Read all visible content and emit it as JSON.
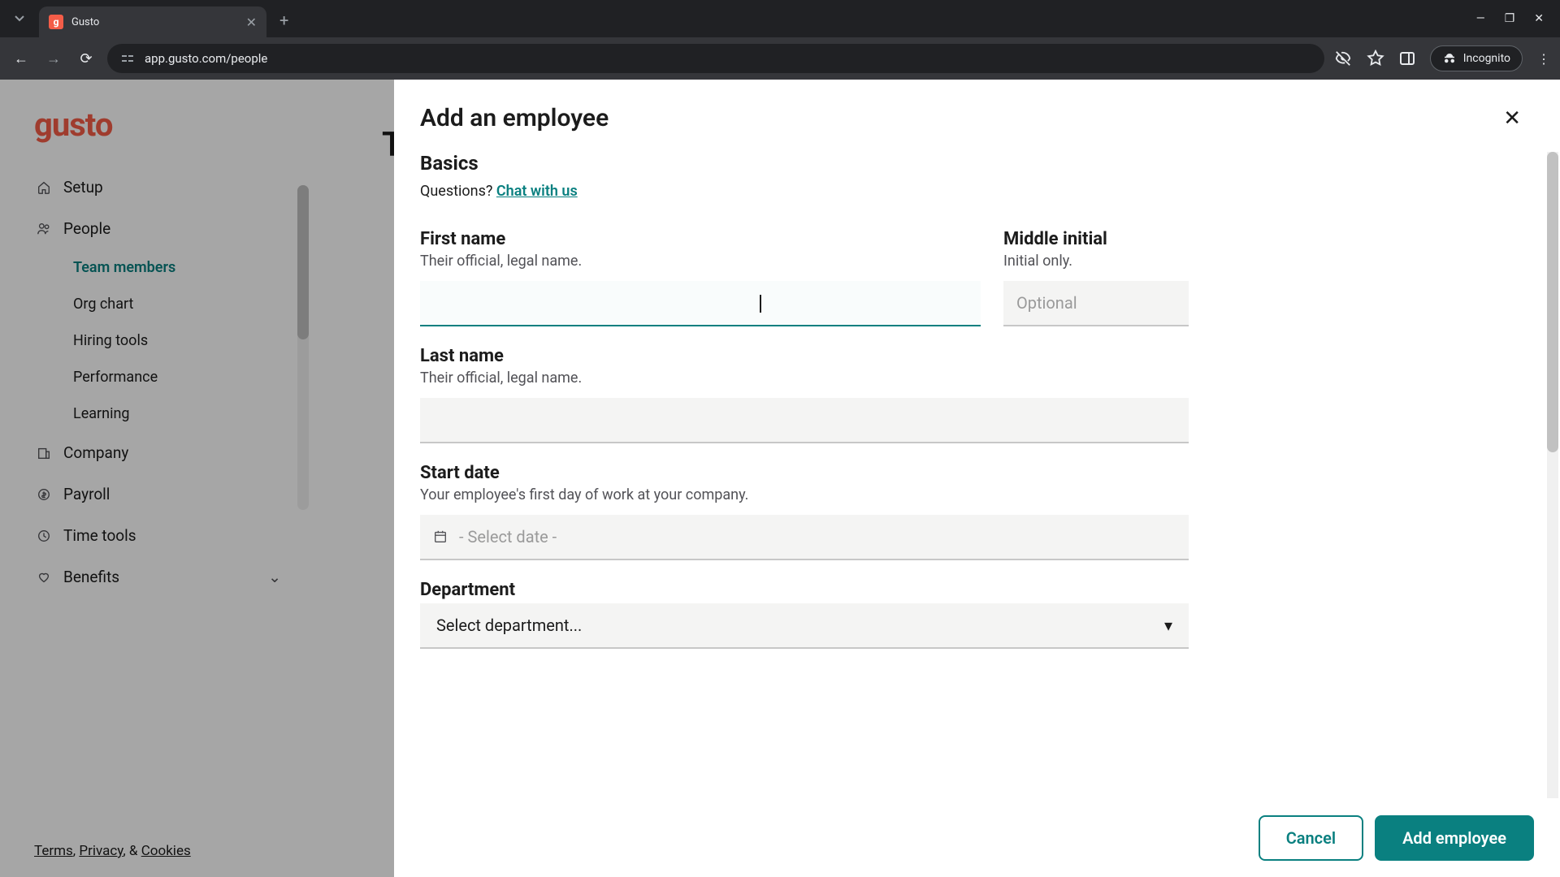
{
  "browser": {
    "tab_title": "Gusto",
    "url": "app.gusto.com/people",
    "incognito_label": "Incognito"
  },
  "sidebar": {
    "logo": "gusto",
    "items": [
      {
        "label": "Setup",
        "icon": "home"
      },
      {
        "label": "People",
        "icon": "people"
      },
      {
        "label": "Company",
        "icon": "company"
      },
      {
        "label": "Payroll",
        "icon": "payroll"
      },
      {
        "label": "Time tools",
        "icon": "clock"
      },
      {
        "label": "Benefits",
        "icon": "heart"
      }
    ],
    "people_sub": [
      {
        "label": "Team members",
        "active": true
      },
      {
        "label": "Org chart",
        "active": false
      },
      {
        "label": "Hiring tools",
        "active": false
      },
      {
        "label": "Performance",
        "active": false
      },
      {
        "label": "Learning",
        "active": false
      }
    ],
    "footer": {
      "terms": "Terms",
      "privacy": "Privacy",
      "amp": ", & ",
      "cookies": "Cookies",
      "sep": ", "
    }
  },
  "page": {
    "title_bg": "T"
  },
  "modal": {
    "title": "Add an employee",
    "section": "Basics",
    "help_prefix": "Questions? ",
    "help_link": "Chat with us",
    "fields": {
      "first_name": {
        "label": "First name",
        "help": "Their official, legal name."
      },
      "middle_initial": {
        "label": "Middle initial",
        "help": "Initial only.",
        "placeholder": "Optional"
      },
      "last_name": {
        "label": "Last name",
        "help": "Their official, legal name."
      },
      "start_date": {
        "label": "Start date",
        "help": "Your employee's first day of work at your company.",
        "placeholder": "- Select date -"
      },
      "department": {
        "label": "Department",
        "placeholder": "Select department..."
      }
    },
    "footer": {
      "cancel": "Cancel",
      "submit": "Add employee"
    }
  }
}
